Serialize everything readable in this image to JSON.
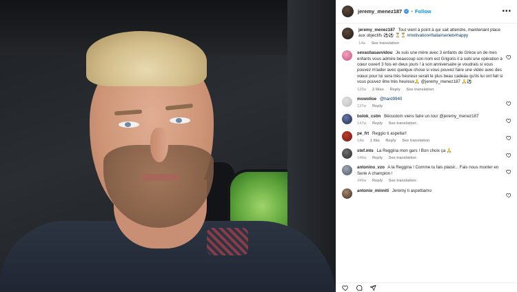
{
  "post": {
    "username": "jeremy_menez187",
    "follow_label": "Follow",
    "more_label": "•••",
    "caption": {
      "text": "Tout vient à point à qui sait attendre, maintenant place aux objectifs ⚽⚽ ⏳⏳",
      "hashtags": "#motivation#Italia#serieb#happy",
      "time": "14w",
      "translation_label": "See translation"
    }
  },
  "comments": [
    {
      "username": "sevastiasavvidou",
      "text": "Je suis une mère avec 3 enfants de Grèce un de mes enfants vous admire beaucoup son nom est Grigoris il a subi une opération à cœur ouvert 3 fois en deux jours ! à son anniversaire je voudrais si vous pouvez m'aider avec quelque chose si vous pouvez faire une vidéo avec des vœux pour lui sera très heureux serait le plus beau cadeau qu'ils lui ont fait si vous pouvez être très heureux🙏 @jeremy_menez187 🙏⚽",
      "time": "122w",
      "likes": "2 likes",
      "reply": "Reply",
      "translation": "See translation"
    },
    {
      "username": "mxwolloe",
      "text": "@hard9940",
      "time": "137w",
      "likes": "",
      "reply": "Reply",
      "translation": ""
    },
    {
      "username": "bolok_cstm",
      "text": "Bécustom viens faire un tour @jeremy_menez187",
      "time": "147w",
      "likes": "",
      "reply": "Reply",
      "translation": "See translation"
    },
    {
      "username": "pe_frt",
      "text": "Reggio ti aspetta!!",
      "time": "14w",
      "likes": "1 like",
      "reply": "Reply",
      "translation": "See translation"
    },
    {
      "username": "stef.mts",
      "text": "La Reggina mon gars ! Bon choix ça 🙏",
      "time": "149w",
      "likes": "",
      "reply": "Reply",
      "translation": "See translation"
    },
    {
      "username": "antonino_vzo",
      "text": "A la Reggina ! Comme tu fais plaisir... Fais nous monter en Serie A champion !",
      "time": "349w",
      "likes": "",
      "reply": "Reply",
      "translation": "See translation"
    },
    {
      "username": "antonio_minniti",
      "text": "Jeremy ti aspettiamo",
      "time": "",
      "likes": "",
      "reply": "",
      "translation": ""
    }
  ],
  "icons": {
    "verified": "verified-badge",
    "like": "heart-icon",
    "comment": "comment-icon",
    "share": "paper-plane-icon"
  },
  "colors": {
    "accent": "#0095f6",
    "verified": "#3897f0",
    "muted": "#8e8e8e"
  }
}
